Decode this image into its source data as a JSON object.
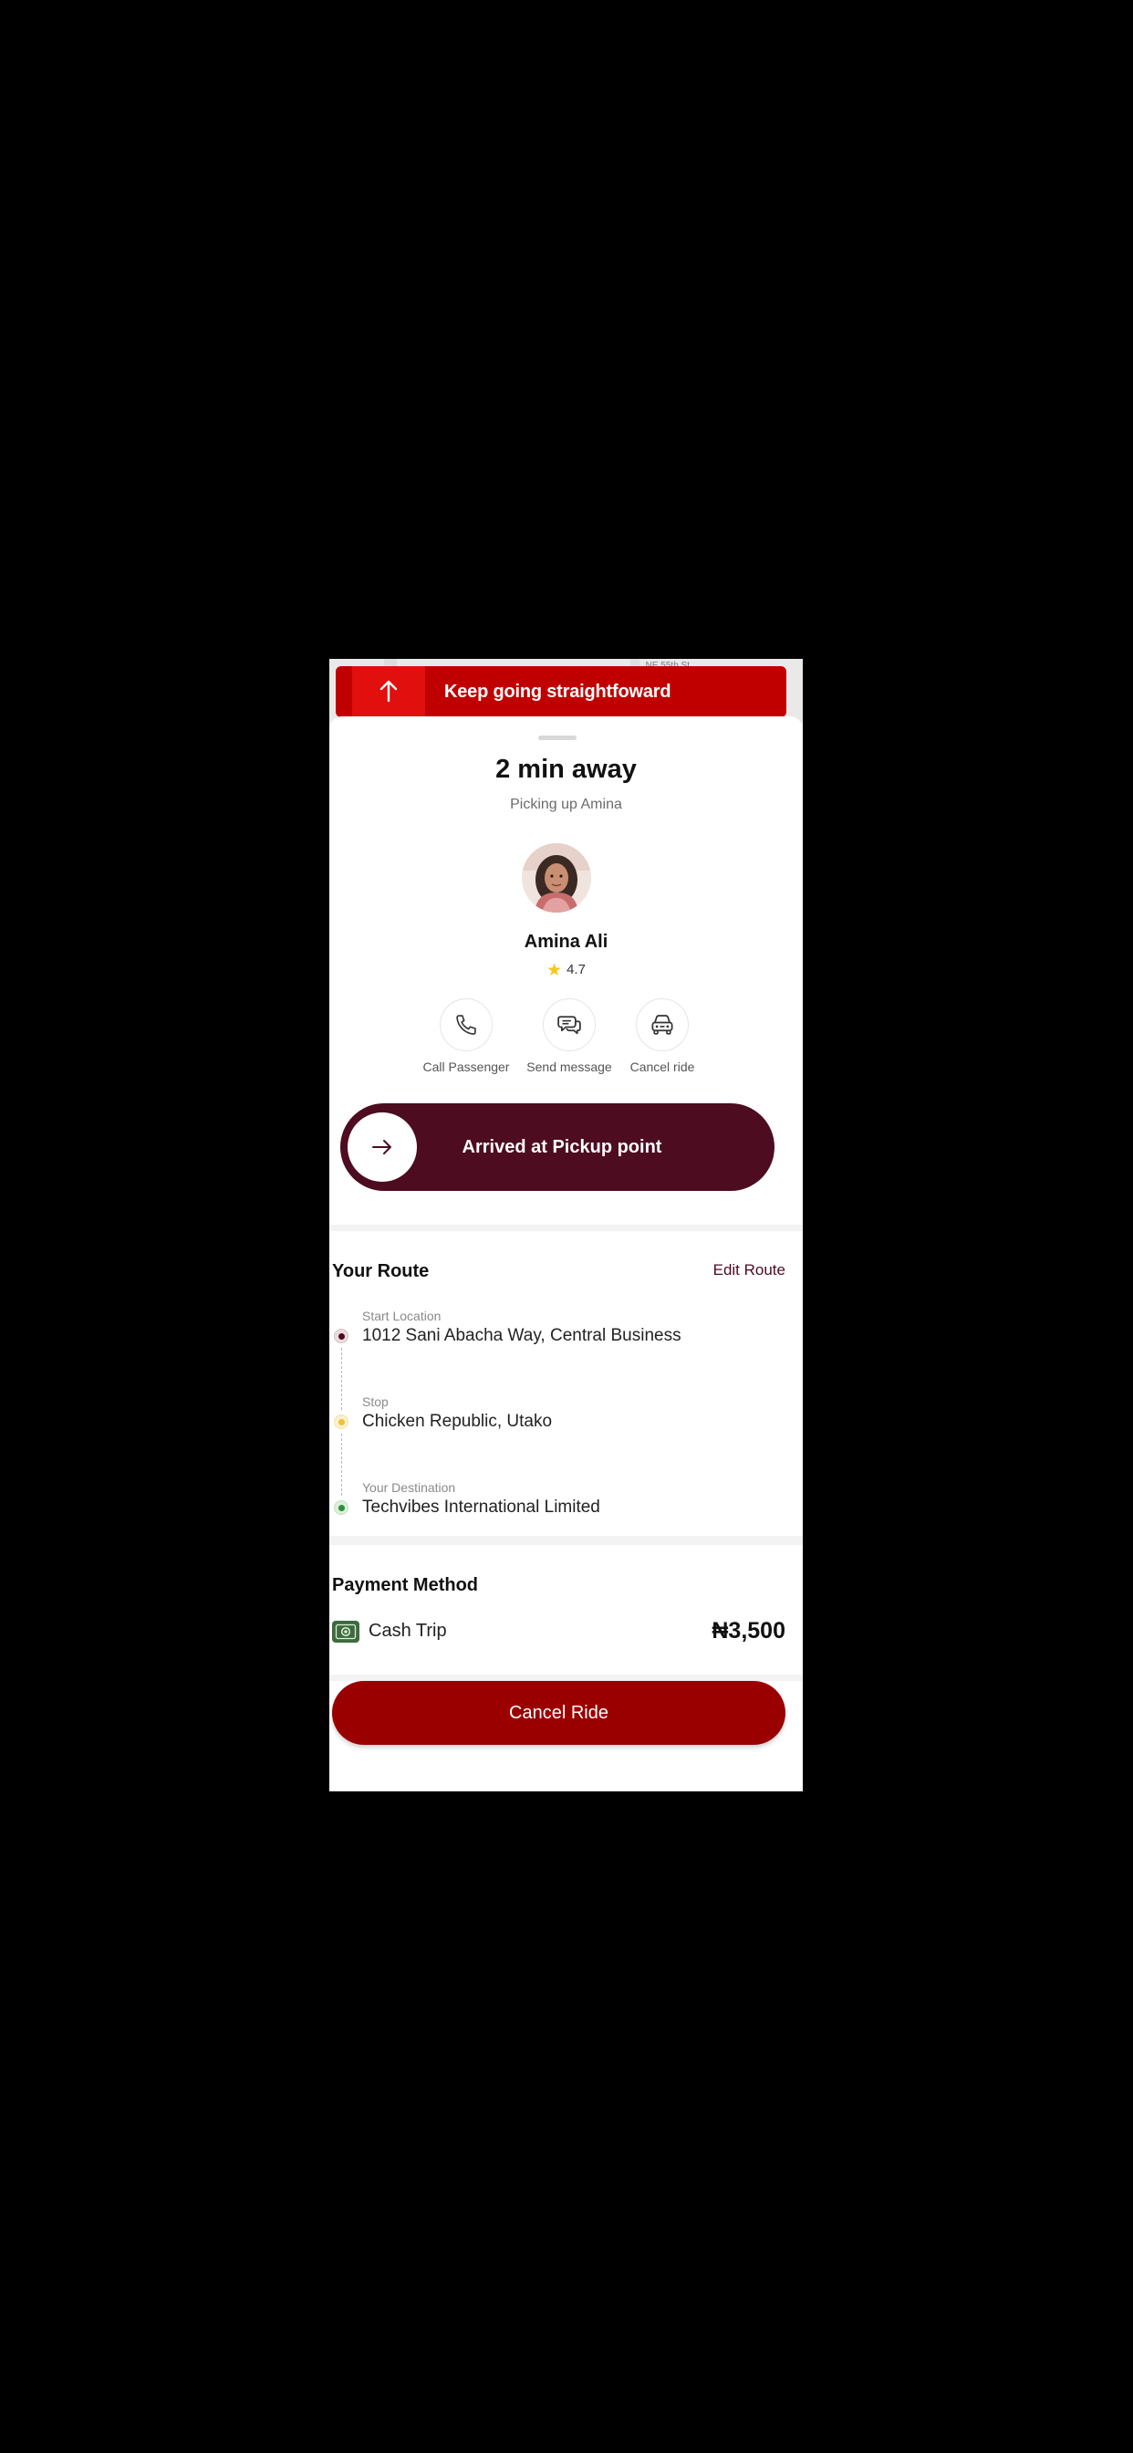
{
  "navigation": {
    "instruction": "Keep going straightfoward",
    "direction_icon": "arrow-up-icon",
    "street_label": "NE 55th St"
  },
  "ride": {
    "eta": "2 min away",
    "status": "Picking up Amina"
  },
  "passenger": {
    "name": "Amina Ali",
    "rating": "4.7"
  },
  "actions": [
    {
      "label": "Call Passenger",
      "icon": "phone-icon"
    },
    {
      "label": "Send message",
      "icon": "chat-icon"
    },
    {
      "label": "Cancel ride",
      "icon": "car-icon"
    }
  ],
  "slider": {
    "label": "Arrived at Pickup point",
    "icon": "arrow-right-icon"
  },
  "route": {
    "title": "Your Route",
    "edit_label": "Edit Route",
    "stops": [
      {
        "caption": "Start Location",
        "address": "1012 Sani Abacha Way, Central Business"
      },
      {
        "caption": "Stop",
        "address": "Chicken Republic, Utako"
      },
      {
        "caption": "Your Destination",
        "address": "Techvibes International Limited"
      }
    ]
  },
  "payment": {
    "title": "Payment Method",
    "method": "Cash Trip",
    "amount": "₦3,500",
    "icon": "cash-icon"
  },
  "footer": {
    "cancel_label": "Cancel Ride"
  },
  "colors": {
    "banner_red": "#c00000",
    "banner_arrow_red": "#e20f0f",
    "maroon": "#4d0c20",
    "cancel_red": "#9a0000",
    "star_yellow": "#f6c623"
  }
}
